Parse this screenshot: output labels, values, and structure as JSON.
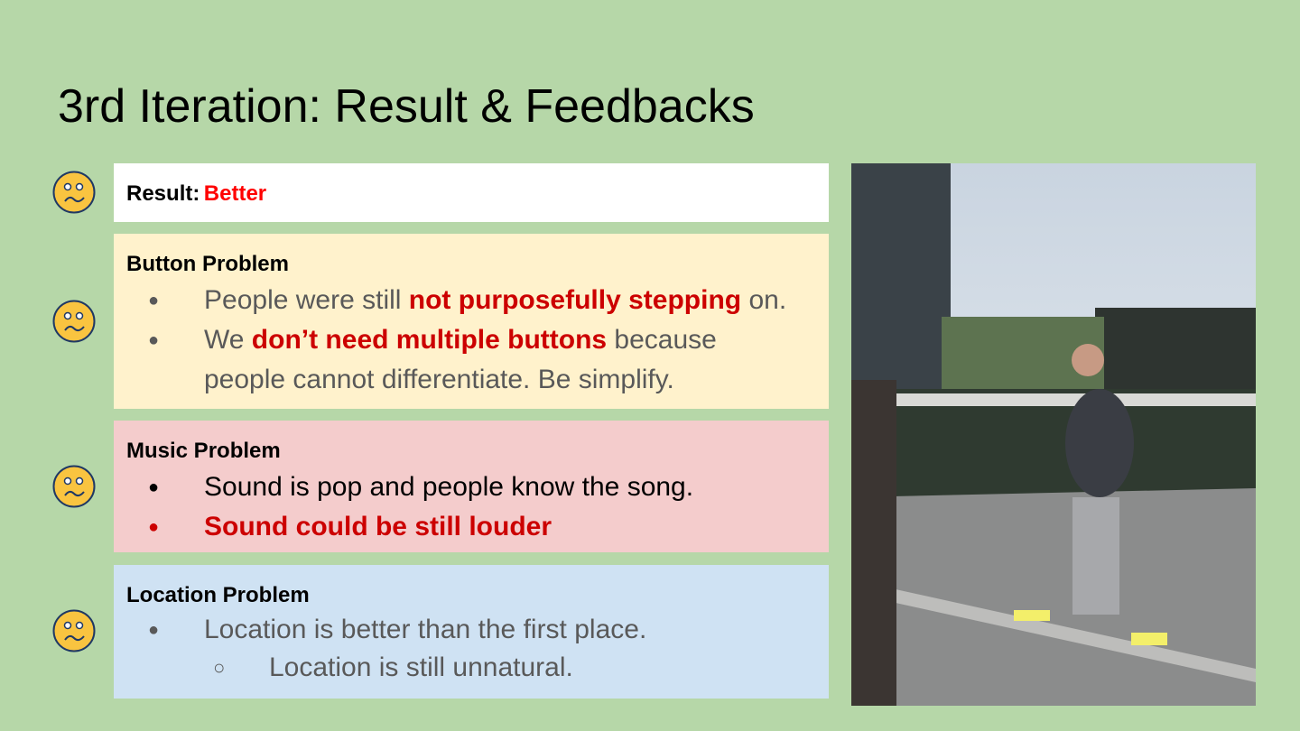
{
  "title": "3rd Iteration: Result & Feedbacks",
  "result": {
    "label": "Result:",
    "value": "Better"
  },
  "button_problem": {
    "heading": "Button Problem",
    "b1": {
      "pre": "People were still ",
      "em": "not purposefully stepping",
      "post": " on."
    },
    "b2": {
      "pre": "We ",
      "em": "don’t need multiple buttons",
      "post": " because people cannot differentiate. Be simplify."
    }
  },
  "music_problem": {
    "heading": "Music Problem",
    "b1": "Sound is pop and people know the song.",
    "b2": "Sound could be still louder"
  },
  "location_problem": {
    "heading": "Location Problem",
    "b1": "Location is better than the first place.",
    "b2": "Location is still unnatural."
  },
  "bullets": {
    "filled": "●",
    "hollow": "○"
  },
  "colors": {
    "background": "#b6d7a8",
    "emphasis": "#cc0000",
    "better": "#ff0000",
    "button_bg": "#fff2cc",
    "music_bg": "#f4cccc",
    "location_bg": "#cfe2f3"
  }
}
